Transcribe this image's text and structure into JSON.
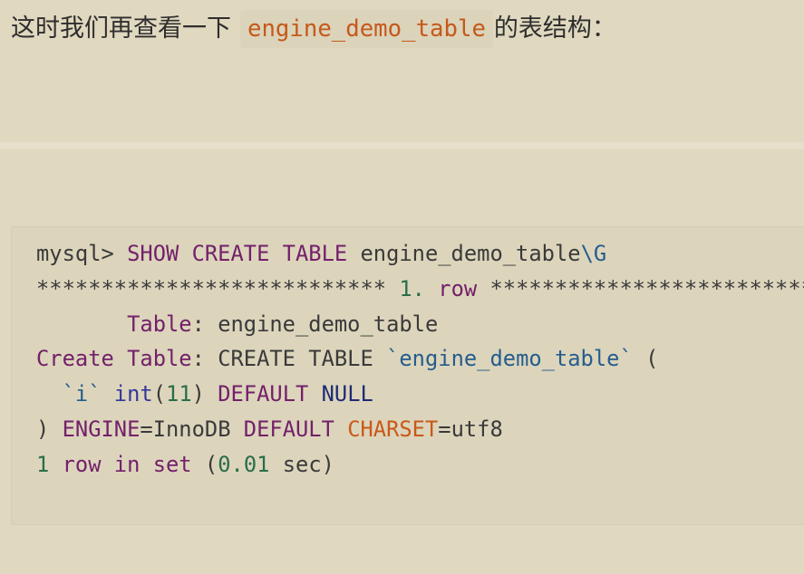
{
  "paragraph": {
    "lead_text": "这时我们再查看一下",
    "inline_code": "engine_demo_table",
    "trail_text": "的表结构："
  },
  "code_block": {
    "lines": [
      [
        "mysql> ",
        "SHOW CREATE TABLE",
        " engine_demo_table",
        "\\G"
      ],
      [
        "*************************** ",
        "1.",
        " row",
        " ***************************"
      ],
      [
        "       Table",
        ": engine_demo_table"
      ],
      [
        "Create Table",
        ": CREATE TABLE ",
        "`engine_demo_table`",
        " ("
      ],
      [
        "  `i`",
        " int",
        "(",
        "11",
        ") ",
        "DEFAULT",
        " NULL"
      ],
      [
        ") ",
        "ENGINE",
        "=InnoDB ",
        "DEFAULT",
        " CHARSET",
        "=utf8"
      ],
      [
        "1",
        " row in set",
        " (",
        "0.01",
        " sec)"
      ]
    ]
  },
  "colors": {
    "page_background": "#e0d8bf",
    "body_text": "#2e2e2e",
    "inline_code_background": "#dbd3ba",
    "inline_code_text": "#c5591a",
    "divider": "#e6dfc9",
    "code_background": "#dcd5bc",
    "code_border": "#d4cdb3",
    "code_text": "#3a3a3a",
    "keyword": "#74206a",
    "identifier": "#265d8d",
    "number": "#2a6d4a",
    "type": "#35379a",
    "literal": "#1f2b74",
    "builtin": "#c9591a"
  }
}
